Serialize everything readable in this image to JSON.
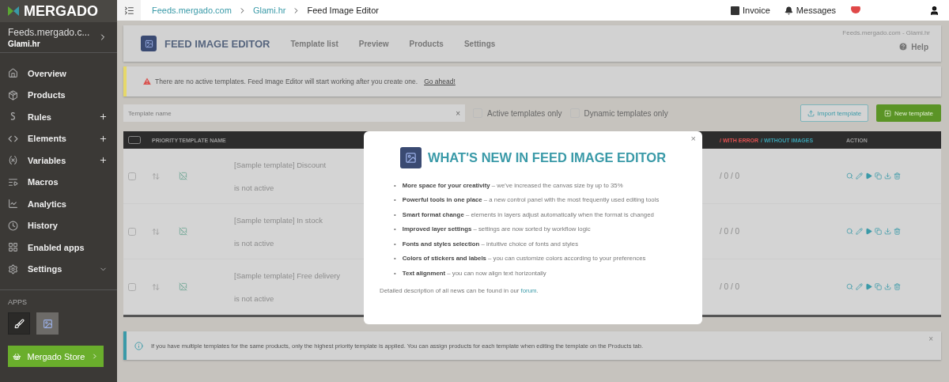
{
  "sidebar": {
    "logo": "MERGADO",
    "account": {
      "title": "Feeds.mergado.c...",
      "subtitle": "Glami.hr"
    },
    "items": [
      {
        "label": "Overview",
        "kind": "plain"
      },
      {
        "label": "Products",
        "kind": "plain"
      },
      {
        "label": "Rules",
        "kind": "plus"
      },
      {
        "label": "Elements",
        "kind": "plus"
      },
      {
        "label": "Variables",
        "kind": "plus"
      },
      {
        "label": "Macros",
        "kind": "plain"
      },
      {
        "label": "Analytics",
        "kind": "plain"
      },
      {
        "label": "History",
        "kind": "plain"
      },
      {
        "label": "Enabled apps",
        "kind": "plain"
      },
      {
        "label": "Settings",
        "kind": "expand"
      }
    ],
    "apps_label": "APPS",
    "apps": [
      {
        "selected": false
      },
      {
        "selected": true
      }
    ],
    "store_button": "Mergado Store"
  },
  "topbar": {
    "breadcrumbs": [
      {
        "label": "Feeds.mergado.com",
        "link": true
      },
      {
        "label": "Glami.hr",
        "link": true
      },
      {
        "label": "Feed Image Editor",
        "link": false
      }
    ],
    "invoice": "Invoice",
    "messages": "Messages"
  },
  "header": {
    "title": "FEED IMAGE EDITOR",
    "tabs": [
      "Template list",
      "Preview",
      "Products",
      "Settings"
    ],
    "context": "Feeds.mergado.com - Glami.hr",
    "help": "Help"
  },
  "alert": {
    "text": "There are no active templates. Feed Image Editor will start working after you create one.",
    "link": "Go ahead!"
  },
  "filters": {
    "placeholder": "Template name",
    "clear": "×",
    "checks": [
      {
        "label": "Active templates only",
        "checked": false
      },
      {
        "label": "Dynamic templates only",
        "checked": false
      }
    ],
    "import_button": "Import template",
    "new_button": "New template"
  },
  "table": {
    "select_all_checked": false,
    "columns": [
      "PRIORITY",
      "TEMPLATE NAME"
    ],
    "counts_header": [
      {
        "text": "/ WITH ERROR",
        "color": "#e05050"
      },
      {
        "text": "/ WITHOUT IMAGES",
        "color": "#3aa0b0"
      }
    ],
    "action_header": "ACTION",
    "rows": [
      {
        "name": "[Sample template] Discount",
        "status": "is not active",
        "counts": "/ 0 / 0",
        "checked": false
      },
      {
        "name": "[Sample template] In stock",
        "status": "is not active",
        "counts": "/ 0 / 0",
        "checked": false
      },
      {
        "name": "[Sample template] Free delivery",
        "status": "is not active",
        "counts": "/ 0 / 0",
        "checked": false
      }
    ]
  },
  "info": {
    "text": "If you have multiple templates for the same products, only the highest priority template is applied. You can assign products for each template when editing the template on the Products tab.",
    "close": "×"
  },
  "modal": {
    "close": "×",
    "title": "WHAT'S NEW IN FEED IMAGE EDITOR",
    "bullet": "•",
    "features": [
      "**More space for your creativity** – we've increased the canvas size by up to 35%",
      "**Powerful tools in one place** – a new control panel with the most frequently used editing tools",
      "**Smart format change** – elements in layers adjust automatically when the format is changed",
      "**Improved layer settings** – settings are now sorted by workflow logic",
      "**Fonts and styles selection** – intuitive choice of fonts and styles",
      "**Colors of stickers and labels** – you can customize colors according to your preferences",
      "**Text alignment** – you can now align text horizontally"
    ],
    "footer": {
      "before": "Detailed description of all news can be found in our",
      "link": "forum",
      "after": "."
    }
  }
}
